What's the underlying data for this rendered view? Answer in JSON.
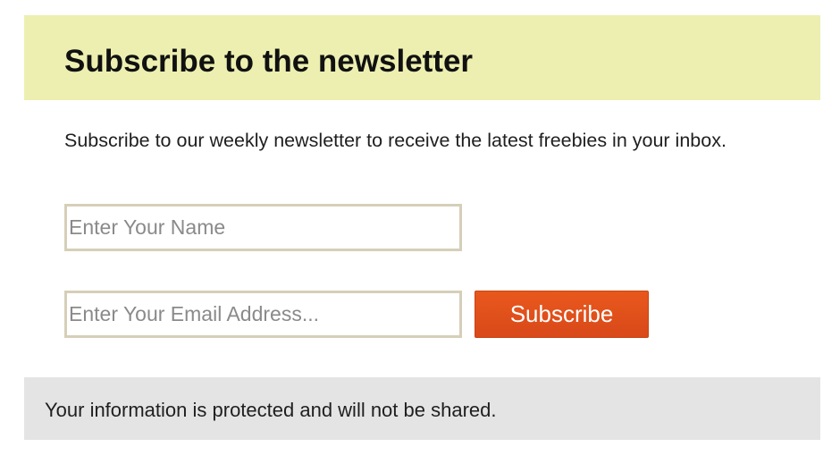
{
  "header": {
    "title": "Subscribe to the newsletter"
  },
  "body": {
    "description": "Subscribe to our weekly newsletter to receive the latest freebies in your inbox."
  },
  "form": {
    "name_field": {
      "value": "",
      "placeholder": "Enter Your Name"
    },
    "email_field": {
      "value": "",
      "placeholder": "Enter Your Email Address..."
    },
    "subscribe_label": "Subscribe"
  },
  "footer": {
    "notice": "Your information is protected and will not be shared."
  },
  "colors": {
    "header_background": "#ecefb0",
    "button_accent": "#e2521b",
    "field_border": "#d6cfb8",
    "footer_background": "#e4e4e4"
  }
}
